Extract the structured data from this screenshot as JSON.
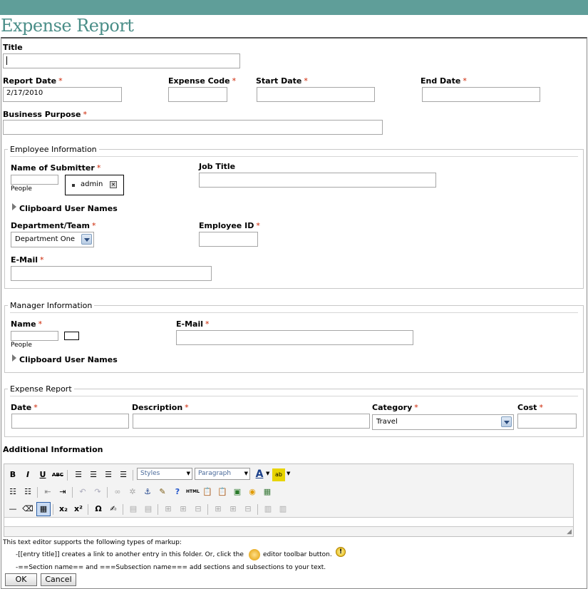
{
  "page": {
    "title": "Expense Report"
  },
  "form": {
    "title_label": "Title",
    "report_date_label": "Report Date",
    "report_date_value": "2/17/2010",
    "expense_code_label": "Expense Code",
    "start_date_label": "Start Date",
    "end_date_label": "End Date",
    "business_purpose_label": "Business Purpose",
    "required_mark": "*"
  },
  "employee": {
    "legend": "Employee Information",
    "submitter_label": "Name of Submitter",
    "people_hint": "People",
    "selected_user": "admin",
    "job_title_label": "Job Title",
    "clipboard_label": "Clipboard User Names",
    "department_label": "Department/Team",
    "department_value": "Department One",
    "employee_id_label": "Employee ID",
    "email_label": "E-Mail"
  },
  "manager": {
    "legend": "Manager Information",
    "name_label": "Name",
    "people_hint": "People",
    "email_label": "E-Mail",
    "clipboard_label": "Clipboard User Names"
  },
  "expense": {
    "legend": "Expense Report",
    "date_label": "Date",
    "description_label": "Description",
    "category_label": "Category",
    "category_value": "Travel",
    "cost_label": "Cost"
  },
  "additional": {
    "label": "Additional Information",
    "styles_select": "Styles",
    "paragraph_select": "Paragraph",
    "help_line1": "This text editor supports the following types of markup:",
    "help_line2a": "-[[entry title]] creates a link to another entry in this folder. Or, click the",
    "help_line2b": "editor toolbar button.",
    "help_line3": "-==Section name== and ===Subsection name=== add sections and subsections to your text."
  },
  "buttons": {
    "ok": "OK",
    "cancel": "Cancel"
  },
  "toolbar": {
    "bold": "B",
    "italic": "I",
    "underline": "U",
    "strike": "ABC",
    "html": "HTML",
    "omega": "Ω",
    "sub": "x₂",
    "sup": "x²",
    "font_color": "A"
  }
}
